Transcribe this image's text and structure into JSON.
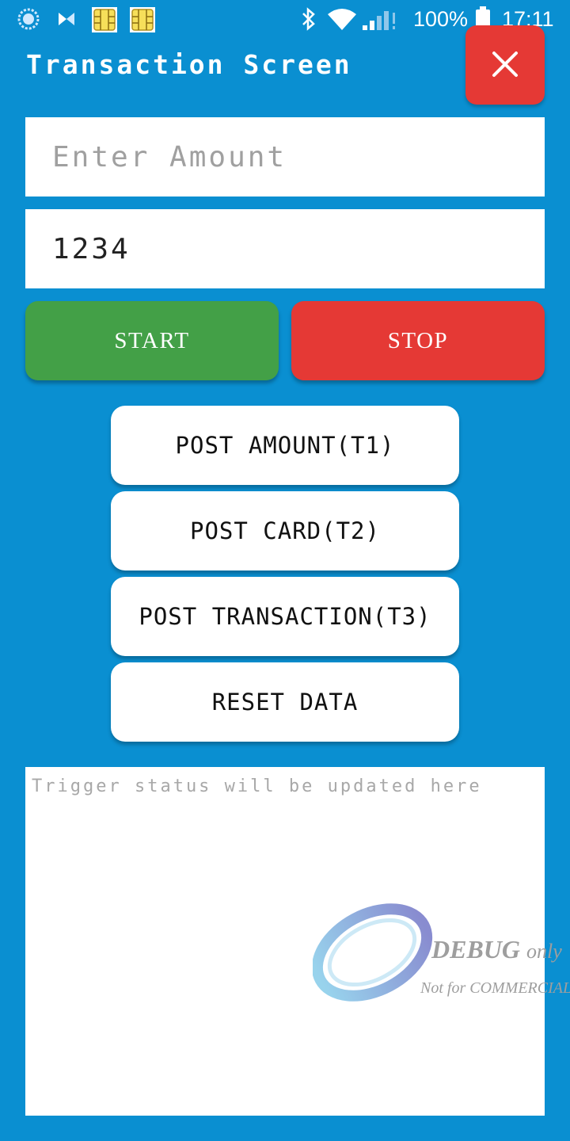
{
  "statusbar": {
    "battery_percent": "100%",
    "time": "17:11",
    "icons": [
      "loading-icon",
      "app-notification-icon",
      "sim-card-icon",
      "sim-card-icon",
      "bluetooth-icon",
      "wifi-icon",
      "cellular-signal-icon",
      "battery-icon"
    ]
  },
  "header": {
    "title": "Transaction Screen",
    "close_icon": "close-icon"
  },
  "form": {
    "amount_placeholder": "Enter Amount",
    "amount_value": "",
    "second_field_value": "1234"
  },
  "actions": {
    "start_label": "START",
    "stop_label": "STOP"
  },
  "triggers": [
    {
      "label": "POST AMOUNT(T1)"
    },
    {
      "label": "POST CARD(T2)"
    },
    {
      "label": "POST TRANSACTION(T3)"
    },
    {
      "label": "RESET DATA"
    }
  ],
  "status": {
    "placeholder": "Trigger status will be updated here"
  },
  "watermark": {
    "line1": "DEBUG",
    "line1_suffix": "only",
    "line2": "Not for COMMERCIAL"
  },
  "colors": {
    "background": "#0a8fd1",
    "start": "#43a047",
    "stop": "#e53935",
    "close": "#e53935",
    "field": "#ffffff"
  }
}
